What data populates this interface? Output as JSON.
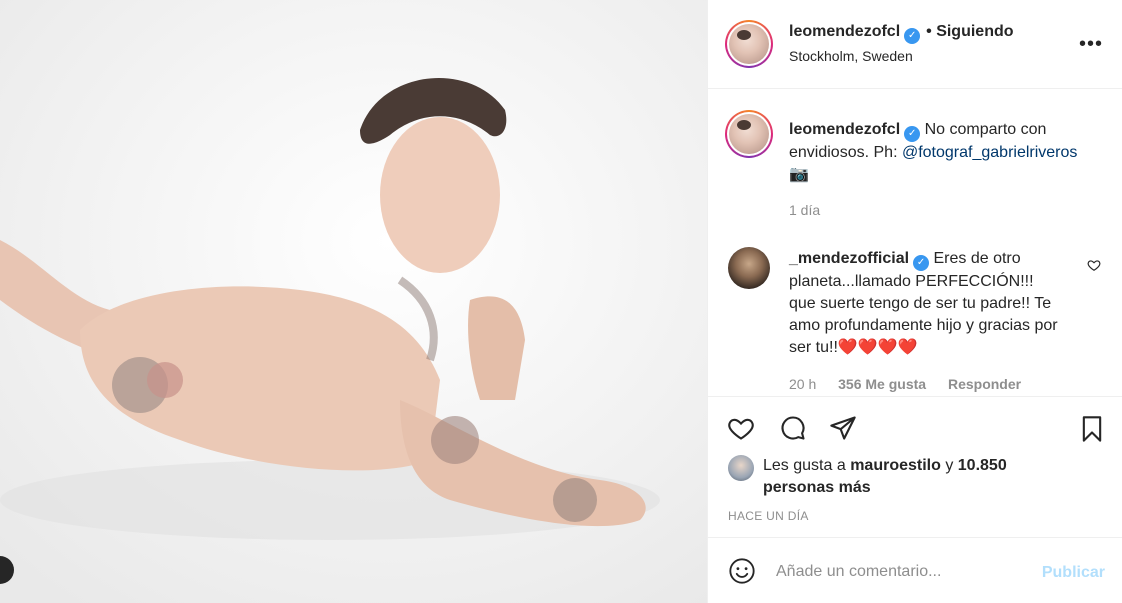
{
  "post": {
    "username": "leomendezofcl",
    "verified": true,
    "follow_status": "• Siguiendo",
    "location": "Stockholm, Sweden",
    "more_icon": "more-horizontal-icon"
  },
  "caption": {
    "username": "leomendezofcl",
    "text": "No comparto con envidiosos. Ph:",
    "mention": "@fotograf_gabrielriveros",
    "emoji": "📷",
    "time": "1 día"
  },
  "comment": {
    "username": "_mendezofficial",
    "text": "Eres de otro planeta...llamado PERFECCIÓN!!! que suerte tengo de ser tu padre!! Te amo profundamente hijo y gracias por ser tu!!",
    "hearts": "❤️❤️❤️❤️",
    "time": "20 h",
    "likes": "356 Me gusta",
    "reply": "Responder"
  },
  "likes": {
    "prefix": "Les gusta a",
    "user": "mauroestilo",
    "connector": "y",
    "others": "10.850 personas más"
  },
  "timestamp": "HACE UN DÍA",
  "input": {
    "placeholder": "Añade un comentario...",
    "publish": "Publicar"
  },
  "colors": {
    "verified": "#3897f0",
    "link": "#00376b",
    "muted": "#8e8e8e",
    "publish_disabled": "#b2dffc",
    "heart_red": "#ed4956"
  }
}
